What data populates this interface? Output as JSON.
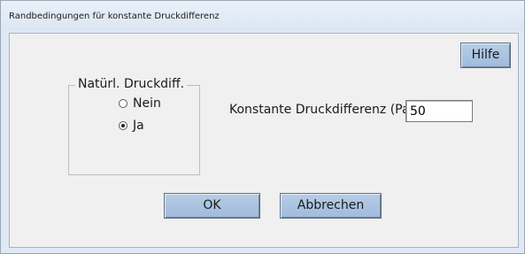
{
  "window": {
    "title": "Randbedingungen für konstante Druckdifferenz"
  },
  "buttons": {
    "help": "Hilfe",
    "ok": "OK",
    "cancel": "Abbrechen"
  },
  "natural_pressure_group": {
    "label": "Natürl. Druckdiff.",
    "options": [
      {
        "label": "Nein",
        "checked": false
      },
      {
        "label": "Ja",
        "checked": true
      }
    ]
  },
  "constant_pressure": {
    "label": "Konstante Druckdifferenz (Pa)",
    "value": "50"
  },
  "colors": {
    "button_fill": "#a9c2e3",
    "dialog_bg": "#f0f0f0",
    "window_bg": "#dfe9f5"
  }
}
